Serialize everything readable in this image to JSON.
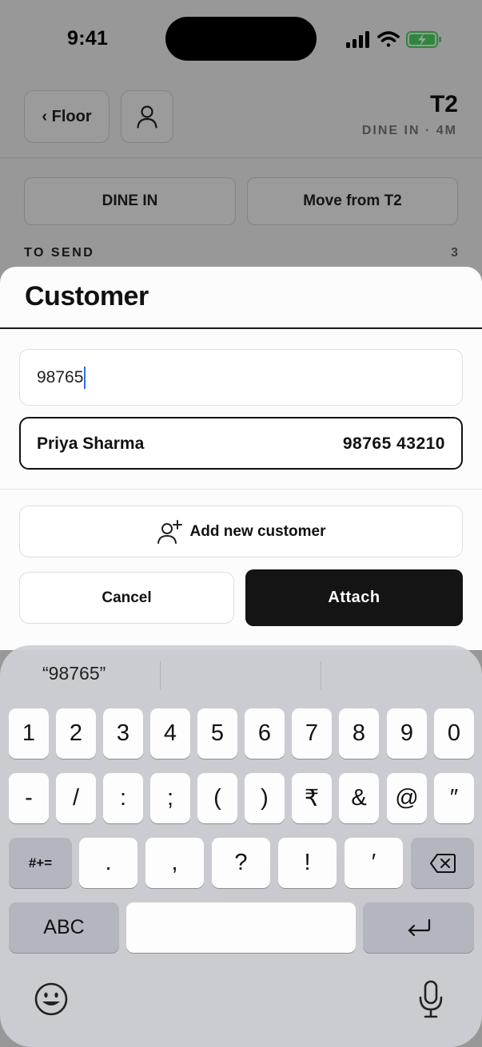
{
  "status_bar": {
    "time": "9:41"
  },
  "header": {
    "back_label": "‹ Floor",
    "table_title": "T2",
    "table_subtitle": "DINE IN · 4M"
  },
  "actions": {
    "dine_in_label": "DINE IN",
    "move_label": "Move from T2"
  },
  "section": {
    "title": "TO SEND",
    "count": "3"
  },
  "sheet": {
    "title": "Customer",
    "search_value": "98765",
    "result": {
      "name": "Priya Sharma",
      "phone": "98765 43210"
    },
    "add_label": "Add new customer",
    "cancel_label": "Cancel",
    "attach_label": "Attach"
  },
  "keyboard": {
    "suggestion": "“98765”",
    "row1": [
      "1",
      "2",
      "3",
      "4",
      "5",
      "6",
      "7",
      "8",
      "9",
      "0"
    ],
    "row2": [
      "-",
      "/",
      ":",
      ";",
      "(",
      ")",
      "₹",
      "&",
      "@",
      "″"
    ],
    "row3": [
      ".",
      ",",
      "?",
      "!",
      "′"
    ],
    "symbols_label": "#+=",
    "abc_label": "ABC"
  },
  "colors": {
    "accent": "#141414",
    "caret": "#2f6fe0",
    "battery": "#4cd964"
  },
  "icons": [
    "signal-icon",
    "wifi-icon",
    "battery-icon",
    "person-icon",
    "add-person-icon",
    "backspace-icon",
    "return-icon",
    "emoji-icon",
    "microphone-icon"
  ]
}
